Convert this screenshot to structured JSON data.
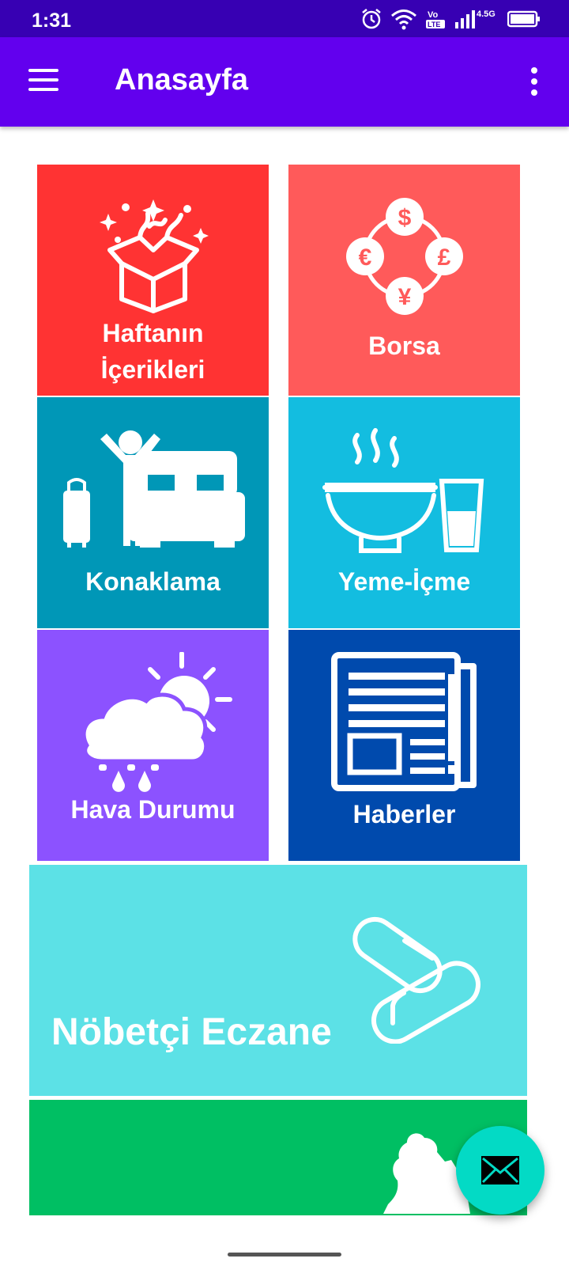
{
  "status_bar": {
    "time": "1:31",
    "network": "4.5G",
    "volte": "Vo LTE"
  },
  "app_bar": {
    "title": "Anasayfa",
    "menu_icon": "hamburger-menu-icon",
    "overflow_icon": "more-vert-icon"
  },
  "tiles": [
    {
      "label_line1": "Haftanın",
      "label_line2": "İçerikleri",
      "color": "#ff3333",
      "icon": "gift-box-icon"
    },
    {
      "label": "Borsa",
      "color": "#ff5a5a",
      "icon": "currency-exchange-icon"
    },
    {
      "label": "Konaklama",
      "color": "#0097b7",
      "icon": "hotel-bed-icon"
    },
    {
      "label": "Yeme-İçme",
      "color": "#13bde0",
      "icon": "food-drink-icon"
    },
    {
      "label": "Hava Durumu",
      "color": "#8c52ff",
      "icon": "weather-icon"
    },
    {
      "label": "Haberler",
      "color": "#004aad",
      "icon": "newspaper-icon"
    }
  ],
  "wide_tiles": [
    {
      "label": "Nöbetçi Eczane",
      "color": "#5ce1e6",
      "icon": "pills-icon"
    },
    {
      "label": "",
      "color": "#00bf63",
      "icon": "prayer-icon"
    }
  ],
  "fab": {
    "icon": "mail-icon",
    "color": "#03dac5"
  }
}
